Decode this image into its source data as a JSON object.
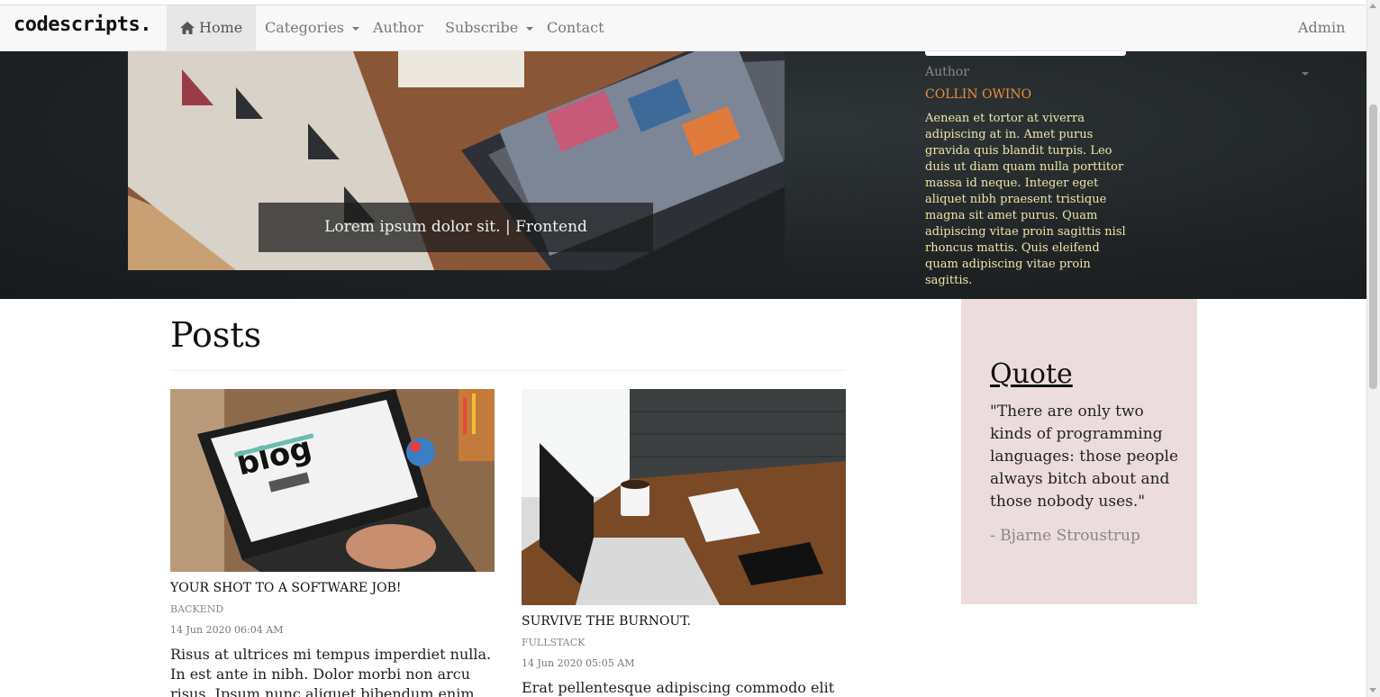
{
  "navbar": {
    "brand": "codescripts.",
    "items": [
      {
        "label": "Home",
        "icon": "home-icon",
        "active": true
      },
      {
        "label": "Categories",
        "dropdown": true
      },
      {
        "label": "Author"
      },
      {
        "label": "Subscribe",
        "dropdown": true
      },
      {
        "label": "Contact"
      }
    ],
    "admin": {
      "label": "Admin",
      "dropdown": true
    }
  },
  "hero": {
    "caption": "Lorem ipsum dolor sit. | Frontend",
    "author_label": "Author",
    "author_name": "COLLIN OWINO",
    "author_bio": "Aenean et tortor at viverra adipiscing at in. Amet purus gravida quis blandit turpis. Leo duis ut diam quam nulla porttitor massa id neque. Integer eget aliquet nibh praesent tristique magna sit amet purus. Quam adipiscing vitae proin sagittis nisl rhoncus mattis. Quis eleifend quam adipiscing vitae proin sagittis."
  },
  "posts": {
    "heading": "Posts",
    "items": [
      {
        "title": "YOUR SHOT TO A SOFTWARE JOB!",
        "category": "BACKEND",
        "date": "14 Jun 2020 06:04 AM",
        "excerpt": "Risus at ultrices mi tempus imperdiet nulla. In est ante in nibh. Dolor morbi non arcu risus. Ipsum nunc aliquet bibendum enim facilisis gravida"
      },
      {
        "title": "SURVIVE THE BURNOUT.",
        "category": "FULLSTACK",
        "date": "14 Jun 2020 05:05 AM",
        "excerpt": "Erat pellentesque adipiscing commodo elit at"
      }
    ]
  },
  "quote": {
    "heading": "Quote",
    "text": "\"There are only two kinds of programming languages: those people always bitch about and those nobody uses.\"",
    "author": "- Bjarne Stroustrup"
  },
  "colors": {
    "navbar_bg": "#f8f8f8",
    "hero_bg": "#1e2224",
    "author_name": "#e8913a",
    "author_bio": "#f0e6a8",
    "quote_bg": "#ecdcdd"
  }
}
